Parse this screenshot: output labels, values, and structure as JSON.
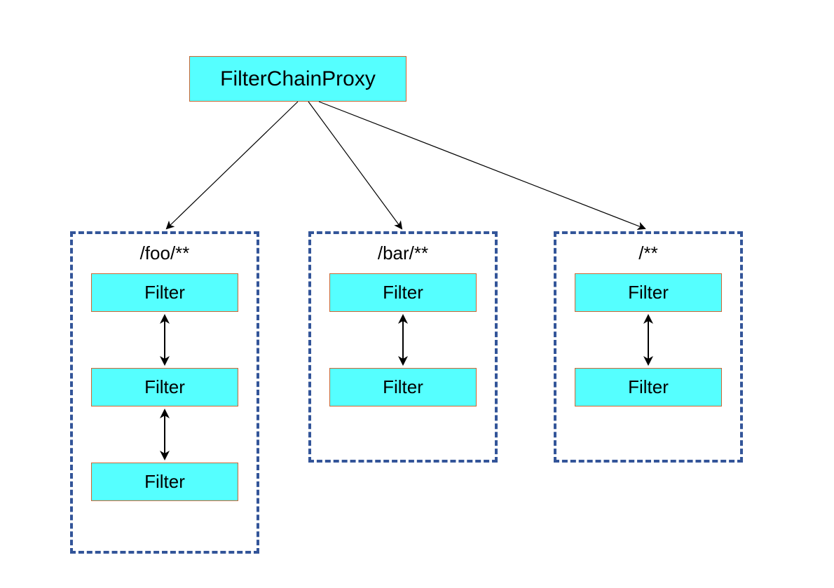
{
  "root": {
    "label": "FilterChainProxy"
  },
  "chains": [
    {
      "pattern": "/foo/**",
      "filters": [
        "Filter",
        "Filter",
        "Filter"
      ]
    },
    {
      "pattern": "/bar/**",
      "filters": [
        "Filter",
        "Filter"
      ]
    },
    {
      "pattern": "/**",
      "filters": [
        "Filter",
        "Filter"
      ]
    }
  ]
}
